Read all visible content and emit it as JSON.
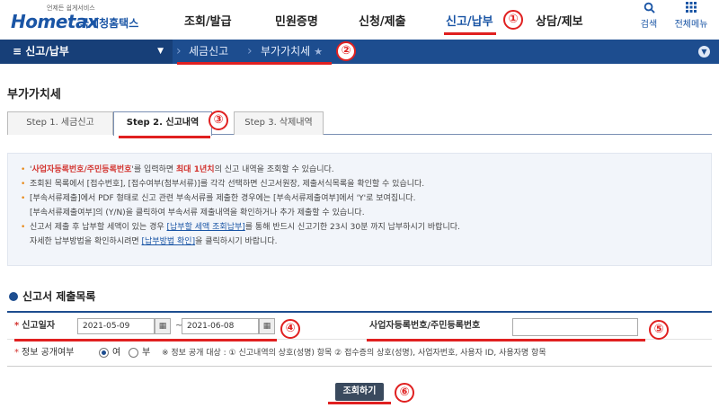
{
  "header": {
    "logo_small": "언제든 쉽게서비스",
    "logo_main": "Hometax",
    "logo_sub": "국세청홈택스",
    "nav": [
      "조회/발급",
      "민원증명",
      "신청/제출",
      "신고/납부",
      "상담/제보"
    ],
    "tools": [
      {
        "icon": "search-icon",
        "label": "검색"
      },
      {
        "icon": "grid-menu-icon",
        "label": "전체메뉴"
      }
    ]
  },
  "bluebar": {
    "menu_label": "≡ 신고/납부",
    "crumbs": [
      "세금신고",
      "부가가치세"
    ]
  },
  "annotations": [
    "①",
    "②",
    "③",
    "④",
    "⑤",
    "⑥"
  ],
  "page": {
    "title": "부가가치세",
    "tabs": [
      "Step 1. 세금신고",
      "Step 2. 신고내역",
      "Step 3. 삭제내역"
    ]
  },
  "notice": {
    "l1_a": "'",
    "l1_red1": "사업자등록번호/주민등록번호",
    "l1_b": "'를 입력하면 ",
    "l1_red2": "최대 1년치",
    "l1_c": "의 신고 내역을 조회할 수 있습니다.",
    "l2": "조회된 목록에서 [접수번호], [접수여부(첨부서류)]를 각각 선택하면 신고서원장, 제출서식목록을 확인할 수 있습니다.",
    "l3": "[부속서류제출]에서 PDF 형태로 신고 관련 부속서류를 제출한 경우에는 [부속서류제출여부]에서 'Y'로 보여집니다.",
    "l3b": "[부속서류제출여부]의 (Y/N)을 클릭하여 부속서류 제출내역을 확인하거나 추가 제출할 수 있습니다.",
    "l4_a": "신고서 제출 후 납부할 세액이 있는 경우 ",
    "l4_link": "[납부할 세액 조회납부]",
    "l4_b": "를 통해 반드시 신고기한 23시 30분 까지 납부하시기 바랍니다.",
    "l4c_a": "자세한 납부방법을 확인하시려면 ",
    "l4c_link": "[납부방법 확인]",
    "l4c_b": "을 클릭하시기 바랍니다."
  },
  "section": {
    "title": "신고서 제출목록"
  },
  "form": {
    "date_label": "신고일자",
    "date_from": "2021-05-09",
    "date_to": "2021-06-08",
    "tilde": "~",
    "id_label": "사업자등록번호/주민등록번호",
    "id_value": "",
    "disclose_label": "정보 공개여부",
    "yes": "여",
    "no": "부",
    "disclose_info": "※ 정보 공개 대상 : ① 신고내역의 상호(성명) 항목 ② 접수증의 상호(성명), 사업자번호, 사용자 ID, 사용자명 항목"
  },
  "search_button": "조회하기",
  "colors": {
    "brand": "#1a55a5",
    "bar": "#1d4d8f",
    "annotation": "#e02020"
  }
}
